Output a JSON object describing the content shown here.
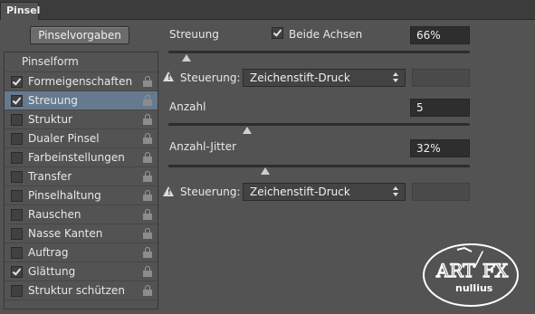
{
  "panel": {
    "tab_title": "Pinsel"
  },
  "preset_button": {
    "label": "Pinselvorgaben"
  },
  "sidebar": {
    "header": "Pinselform",
    "items": [
      {
        "label": "Formeigenschaften",
        "checked": true,
        "selected": false
      },
      {
        "label": "Streuung",
        "checked": true,
        "selected": true
      },
      {
        "label": "Struktur",
        "checked": false,
        "selected": false
      },
      {
        "label": "Dualer Pinsel",
        "checked": false,
        "selected": false
      },
      {
        "label": "Farbeinstellungen",
        "checked": false,
        "selected": false
      },
      {
        "label": "Transfer",
        "checked": false,
        "selected": false
      },
      {
        "label": "Pinselhaltung",
        "checked": false,
        "selected": false
      },
      {
        "label": "Rauschen",
        "checked": false,
        "selected": false
      },
      {
        "label": "Nasse Kanten",
        "checked": false,
        "selected": false
      },
      {
        "label": "Auftrag",
        "checked": false,
        "selected": false
      },
      {
        "label": "Glättung",
        "checked": true,
        "selected": false
      },
      {
        "label": "Struktur schützen",
        "checked": false,
        "selected": false
      }
    ]
  },
  "scatter": {
    "label": "Streuung",
    "both_axes_label": "Beide Achsen",
    "both_axes_checked": true,
    "value": "66%",
    "slider_fraction": 0.06,
    "control_label": "Steuerung:",
    "control_value": "Zeichenstift-Druck"
  },
  "count": {
    "label": "Anzahl",
    "value": "5",
    "slider_fraction": 0.26
  },
  "count_jitter": {
    "label": "Anzahl-Jitter",
    "value": "32%",
    "slider_fraction": 0.32,
    "control_label": "Steuerung:",
    "control_value": "Zeichenstift-Druck"
  },
  "watermark": {
    "text_top": "ART / FX",
    "text_bottom": "nullius"
  },
  "colors": {
    "panel_bg": "#535353",
    "selection": "#667a8f",
    "field_bg": "#2e2e2e"
  }
}
